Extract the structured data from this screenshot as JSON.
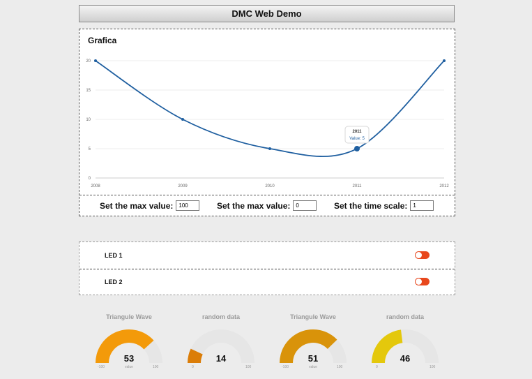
{
  "header": {
    "title": "DMC Web Demo"
  },
  "chart_data": {
    "type": "line",
    "title": "Grafica",
    "x": [
      "2008",
      "2009",
      "2010",
      "2011",
      "2012"
    ],
    "series": [
      {
        "values": [
          20,
          10,
          5,
          5,
          20
        ]
      }
    ],
    "ylim": [
      0,
      20
    ],
    "yticks": [
      0,
      5,
      10,
      15,
      20
    ],
    "grid": true,
    "color": "#1f5fa0",
    "tooltip": {
      "label": "2011",
      "text": "Value: 5"
    }
  },
  "controls": [
    {
      "label": "Set the max value:",
      "value": "100"
    },
    {
      "label": "Set the max value:",
      "value": "0"
    },
    {
      "label": "Set the time scale:",
      "value": "1"
    }
  ],
  "leds": [
    {
      "label": "LED 1",
      "state": "off",
      "color": "#e8481d"
    },
    {
      "label": "LED 2",
      "state": "off",
      "color": "#e8481d"
    }
  ],
  "gauges": [
    {
      "title": "Triangule Wave",
      "value": 53,
      "min": -100,
      "max": 100,
      "unit": "value",
      "color": "#f39a0a"
    },
    {
      "title": "random data",
      "value": 14,
      "min": 0,
      "max": 100,
      "unit": "",
      "color": "#db7d08"
    },
    {
      "title": "Triangule Wave",
      "value": 51,
      "min": -100,
      "max": 100,
      "unit": "value",
      "color": "#d9930a"
    },
    {
      "title": "random data",
      "value": 46,
      "min": 0,
      "max": 100,
      "unit": "",
      "color": "#e4c80c"
    }
  ]
}
